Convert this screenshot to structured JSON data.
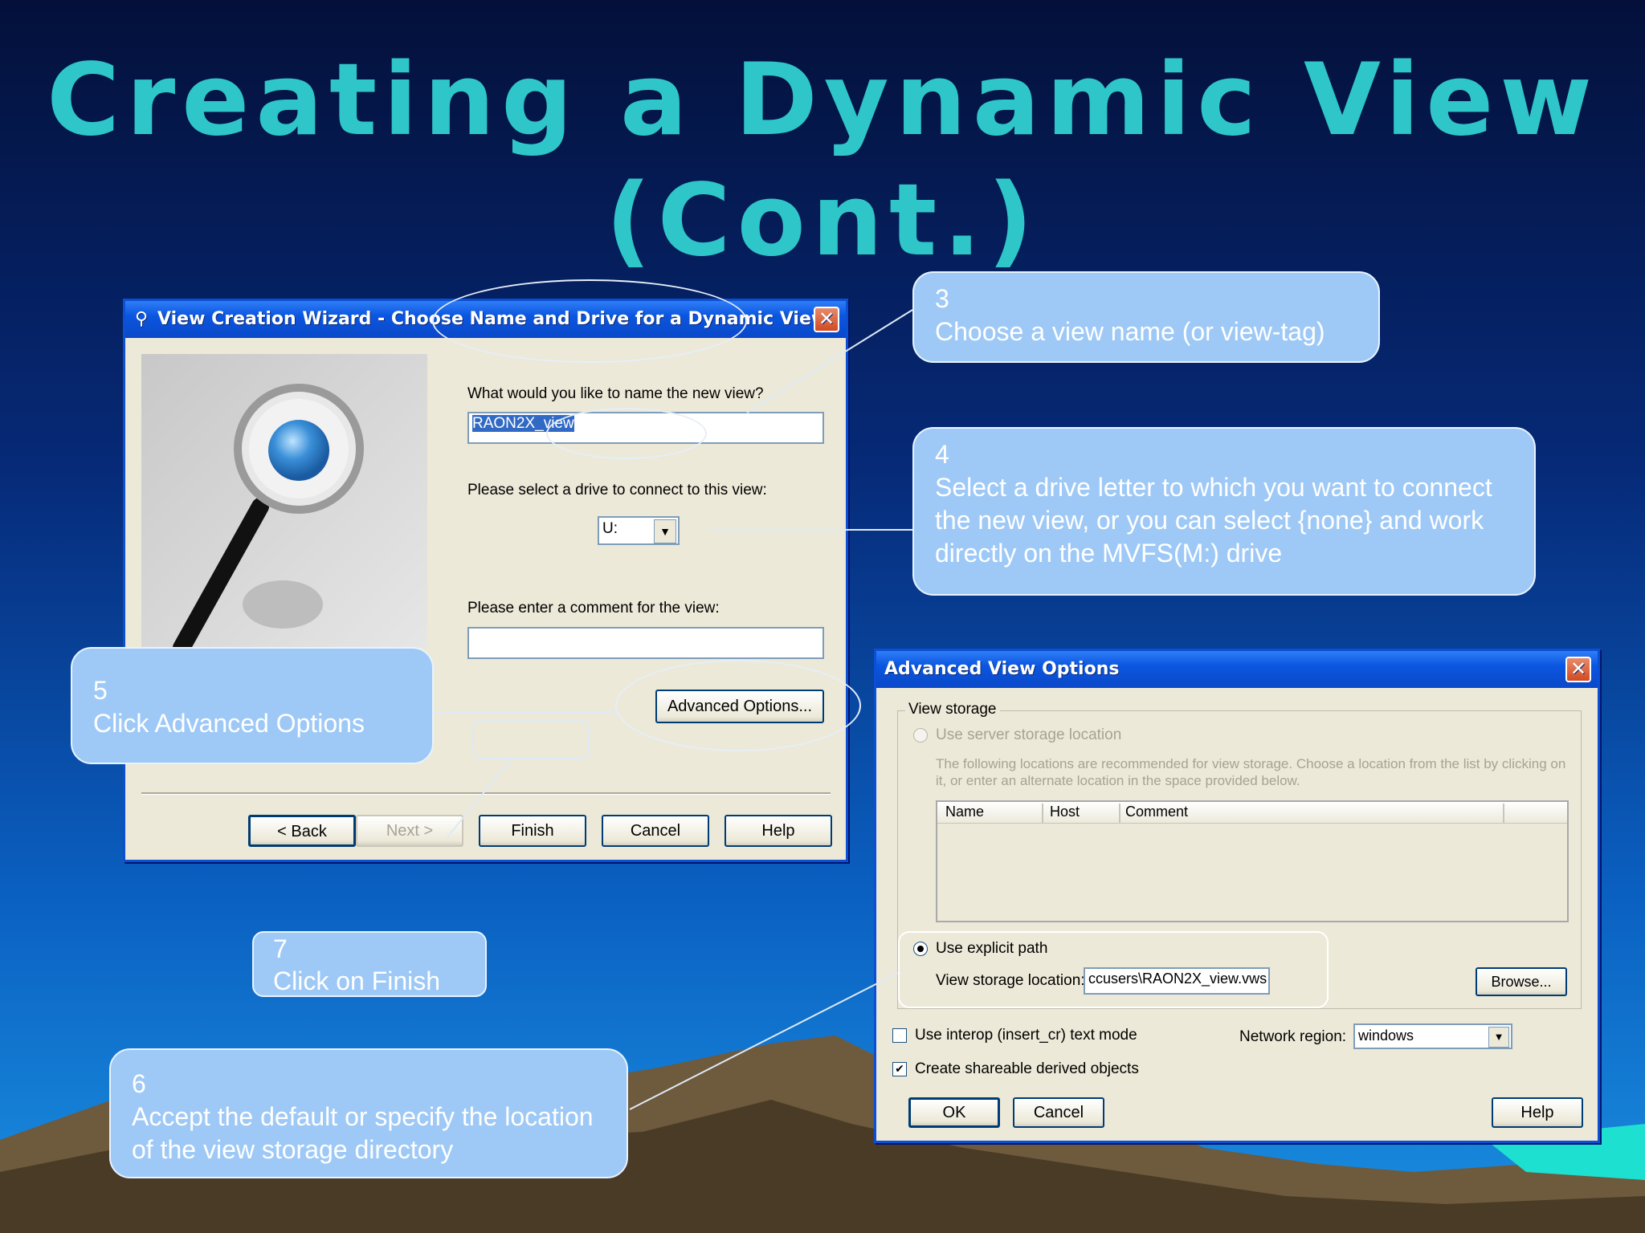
{
  "slide": {
    "title_line1": "Creating a Dynamic View",
    "title_line2": "(Cont.)"
  },
  "wizard": {
    "title": "View Creation Wizard - Choose Name and Drive for a Dynamic View",
    "close_glyph": "✕",
    "name_prompt": "What would you like to name the new view?",
    "name_value": "RAON2X_view",
    "drive_prompt": "Please select a drive to connect to this view:",
    "drive_value": "U:",
    "comment_prompt": "Please enter a comment for the view:",
    "comment_value": "",
    "advanced_button": "Advanced Options...",
    "back_button": "< Back",
    "next_button": "Next >",
    "finish_button": "Finish",
    "cancel_button": "Cancel",
    "help_button": "Help"
  },
  "advanced": {
    "title": "Advanced View Options",
    "close_glyph": "✕",
    "view_storage_group": "View storage",
    "use_server_storage": "Use server storage location",
    "recommend_text": "The following locations are recommended for view storage. Choose a location from the list by clicking on it, or enter an alternate location in the space provided below.",
    "columns": [
      "Name",
      "Host",
      "Comment"
    ],
    "use_explicit_path": "Use explicit path",
    "storage_location_label": "View storage location:",
    "storage_location_value": "ccusers\\RAON2X_view.vws",
    "browse_button": "Browse...",
    "interop_label": "Use interop (insert_cr) text mode",
    "interop_checked": false,
    "shareable_label": "Create shareable derived objects",
    "shareable_checked": true,
    "network_region_label": "Network region:",
    "network_region_value": "windows",
    "ok_button": "OK",
    "cancel_button": "Cancel",
    "help_button": "Help"
  },
  "callouts": {
    "c3_number": "3",
    "c3_text": "Choose a view name (or view-tag)",
    "c4_number": "4",
    "c4_text": "Select a drive letter to which you want to connect the new view, or you can select {none} and work directly on the MVFS(M:) drive",
    "c5_number": "5",
    "c5_text": "Click Advanced Options",
    "c6_number": "6",
    "c6_text": "Accept the default or specify the location of the view storage directory",
    "c7_number": "7",
    "c7_text": "Click on Finish"
  },
  "colors": {
    "title": "#2ec6c8",
    "callout": "#9ec9f6",
    "xp_titlebar": "#0b56e0",
    "dialog_bg": "#ece9d8"
  },
  "icons": [
    "wizard-icon",
    "magnifier-illustration",
    "close-icon",
    "dropdown-arrow-icon"
  ]
}
